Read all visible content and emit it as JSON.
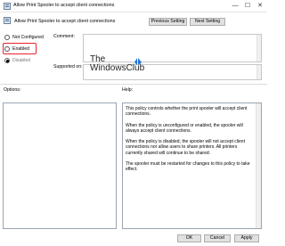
{
  "window": {
    "title": "Allow Print Spooler to accept client connections",
    "min_glyph": "—",
    "max_glyph": "☐",
    "close_glyph": "✕"
  },
  "header": {
    "policy_name": "Allow Print Spooler to accept client connections",
    "prev_label": "Previous Setting",
    "next_label": "Next Setting"
  },
  "state": {
    "options": [
      {
        "label": "Not Configured",
        "checked": false
      },
      {
        "label": "Enabled",
        "checked": false
      },
      {
        "label": "Disabled",
        "checked": true
      }
    ]
  },
  "fields": {
    "comment_label": "Comment:",
    "supported_label": "Supported on:"
  },
  "watermark": {
    "line1": "The",
    "line2": "WindowsClub"
  },
  "panes": {
    "options_label": "Options:",
    "help_label": "Help:",
    "help_paragraphs": [
      "This policy controls whether the print spooler will accept client connections.",
      "When the policy is unconfigured or enabled, the spooler will always accept client connections.",
      "When the policy is disabled, the spooler will not accept client connections nor allow users to share printers.  All printers currently shared will continue to be shared.",
      "The spooler must be restarted for changes to this policy to take effect."
    ]
  },
  "footer": {
    "ok_label": "OK",
    "cancel_label": "Cancel",
    "apply_label": "Apply"
  },
  "colors": {
    "highlight": "#e8232c",
    "watermark_logo": "#1e73d6"
  }
}
